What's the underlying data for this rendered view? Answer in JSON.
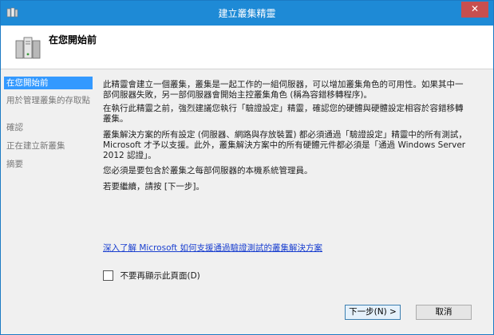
{
  "window": {
    "title": "建立叢集精靈",
    "close_glyph": "✕"
  },
  "header": {
    "title": "在您開始前"
  },
  "nav": {
    "items": [
      {
        "label": "在您開始前",
        "selected": true
      },
      {
        "label": "用於管理叢集的存取點",
        "selected": false
      },
      {
        "label": "確認",
        "selected": false
      },
      {
        "label": "正在建立新叢集",
        "selected": false
      },
      {
        "label": "摘要",
        "selected": false
      }
    ]
  },
  "content": {
    "paragraphs": [
      "此精靈會建立一個叢集，叢集是一起工作的一組伺服器，可以增加叢集角色的可用性。如果其中一部伺服器失敗，另一部伺服器會開始主控叢集角色 (稱為容錯移轉程序)。",
      "在執行此精靈之前，強烈建議您執行「驗證設定」精靈，確認您的硬體與硬體設定相容於容錯移轉叢集。",
      "叢集解決方案的所有設定 (伺服器、網路與存放裝置) 都必須通過「驗證設定」精靈中的所有測試，Microsoft 才予以支援。此外，叢集解決方案中的所有硬體元件都必須是「通過 Windows Server 2012 認證」。",
      "您必須是要包含於叢集之每部伺服器的本機系統管理員。",
      "若要繼續，請按 [下一步]。"
    ],
    "link": "深入了解 Microsoft 如何支援通過驗證測試的叢集解決方案",
    "checkbox": {
      "label": "不要再顯示此頁面(D)",
      "checked": false
    }
  },
  "footer": {
    "next_label": "下一步(N) >",
    "cancel_label": "取消"
  },
  "colors": {
    "titlebar": "#1e8ad6",
    "selected_nav": "#3399ff",
    "link": "#1a3fcf",
    "close": "#c74f4f"
  },
  "icons": {
    "app": "cluster-app-icon",
    "header": "cluster-servers-icon"
  }
}
